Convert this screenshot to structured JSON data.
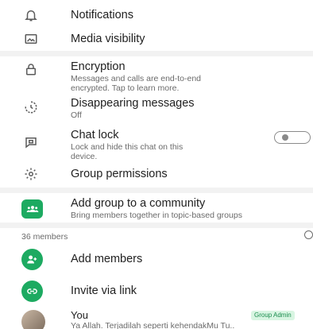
{
  "settings": {
    "notifications": {
      "title": "Notifications",
      "icon": "bell-icon"
    },
    "media_visibility": {
      "title": "Media visibility",
      "icon": "image-icon"
    },
    "encryption": {
      "title": "Encryption",
      "subtitle_line1": "Messages and calls are end-to-end",
      "subtitle_line2": "encrypted. Tap to learn more.",
      "icon": "lock-icon"
    },
    "disappearing": {
      "title": "Disappearing messages",
      "subtitle": "Off",
      "icon": "timer-icon"
    },
    "chat_lock": {
      "title": "Chat lock",
      "subtitle_line1": "Lock and hide this chat on this",
      "subtitle_line2": "device.",
      "icon": "chat-lock-icon",
      "enabled": false
    },
    "group_permissions": {
      "title": "Group permissions",
      "icon": "gear-icon"
    }
  },
  "community": {
    "title": "Add group to a community",
    "subtitle": "Bring members together in topic-based groups",
    "icon": "community-icon"
  },
  "members": {
    "count_label": "36 members",
    "add_members": "Add members",
    "invite_link": "Invite via link",
    "list": [
      {
        "name": "You",
        "status": "Ya Allah. Terjadilah seperti kehendakMu Tu..",
        "badge": "Group Admin"
      }
    ]
  },
  "colors": {
    "accent": "#1daa61",
    "badge_bg": "#d8f5e2",
    "badge_text": "#1b8c4e"
  }
}
